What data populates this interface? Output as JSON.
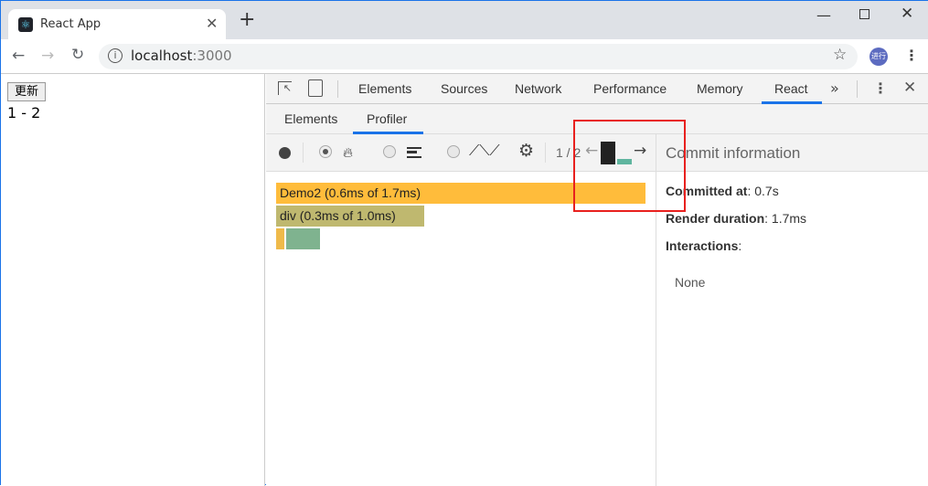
{
  "browser": {
    "tab_title": "React App",
    "url_host": "localhost",
    "url_port": ":3000",
    "avatar_text": "进行"
  },
  "page": {
    "button_label": "更新",
    "text": "1 - 2"
  },
  "devtools": {
    "tabs": [
      "Elements",
      "Sources",
      "Network",
      "Performance",
      "Memory",
      "React"
    ],
    "active_tab": "React",
    "subtabs": [
      "Elements",
      "Profiler"
    ],
    "active_subtab": "Profiler",
    "commit_counter": "1 / 2",
    "flame": [
      {
        "label": "Demo2 (0.6ms of 1.7ms)",
        "color": "#ffbc3b"
      },
      {
        "label": "div (0.3ms of 1.0ms)",
        "color": "#bfb86f"
      }
    ],
    "commit_info": {
      "title": "Commit information",
      "committed_at_label": "Committed at",
      "committed_at": ": 0.7s",
      "render_label": "Render duration",
      "render": ": 1.7ms",
      "interactions_label": "Interactions",
      "interactions_colon": ":",
      "none": "None"
    }
  },
  "colors": {
    "accent": "#1a73e8",
    "highlight_box": "#e8201e"
  }
}
